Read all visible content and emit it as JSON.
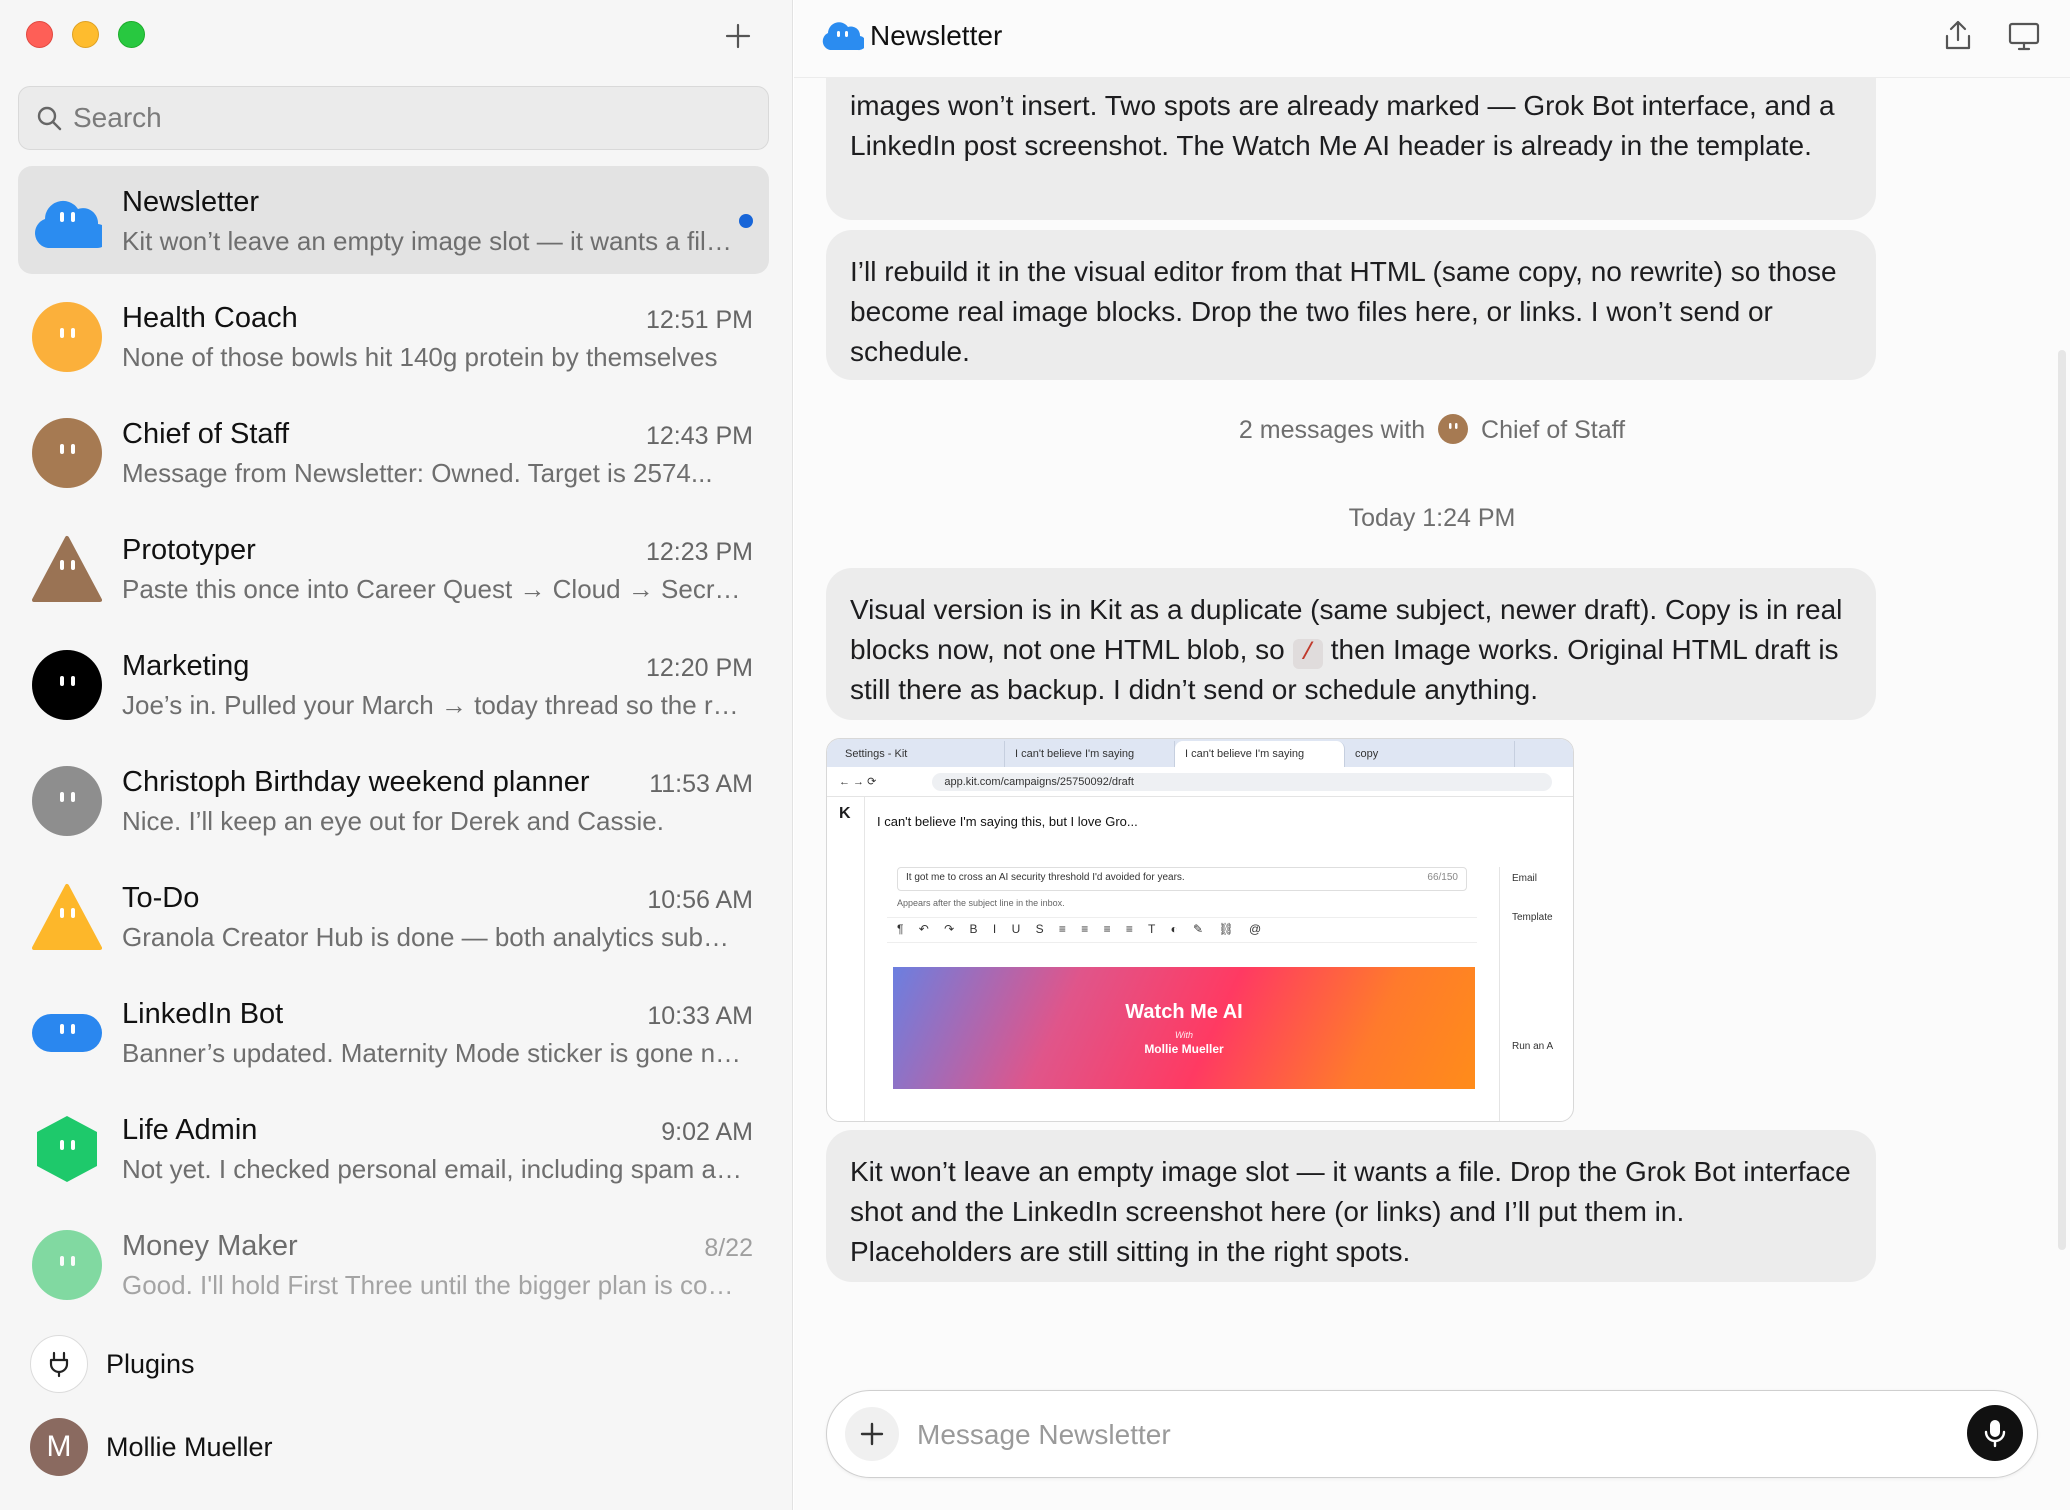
{
  "sidebar": {
    "search_placeholder": "Search",
    "chats": [
      {
        "name": "Newsletter",
        "time": "",
        "preview": "Kit won’t leave an empty image slot — it wants a file. Drop the Grok Bot interface shot",
        "unread": true,
        "color": "#2b8cf0",
        "shape": "cloud"
      },
      {
        "name": "Health Coach",
        "time": "12:51 PM",
        "preview": "None of those bowls hit 140g protein by themselves",
        "color": "#fbb03b",
        "shape": "circle"
      },
      {
        "name": "Chief of Staff",
        "time": "12:43 PM",
        "preview": "Message from Newsletter: Owned. Target is 2574...",
        "color": "#a67a52",
        "shape": "circle"
      },
      {
        "name": "Prototyper",
        "time": "12:23 PM",
        "preview": "Paste this once into Career Quest → Cloud → Secrets",
        "color": "#9a7354",
        "shape": "triangle"
      },
      {
        "name": "Marketing",
        "time": "12:20 PM",
        "preview": "Joe’s in. Pulled your March → today thread so the rest",
        "color": "#000000",
        "shape": "circle"
      },
      {
        "name": "Christoph Birthday weekend planner",
        "time": "11:53 AM",
        "preview": "Nice. I’ll keep an eye out for Derek and Cassie.",
        "color": "#8e8e8e",
        "shape": "circle"
      },
      {
        "name": "To-Do",
        "time": "10:56 AM",
        "preview": "Granola Creator Hub is done — both analytics subpages",
        "color": "#fdb72a",
        "shape": "triangle"
      },
      {
        "name": "LinkedIn Bot",
        "time": "10:33 AM",
        "preview": "Banner’s updated. Maternity Mode sticker is gone now",
        "color": "#2a87ef",
        "shape": "pill"
      },
      {
        "name": "Life Admin",
        "time": "9:02 AM",
        "preview": "Not yet. I checked personal email, including spam and",
        "color": "#1ec96b",
        "shape": "hexagon"
      },
      {
        "name": "Money Maker",
        "time": "8/22",
        "preview": "Good. I'll hold First Three until the bigger plan is complete",
        "color": "#35c76a",
        "shape": "circle",
        "faded": true
      }
    ],
    "plugins_label": "Plugins",
    "user_initial": "M",
    "user_name": "Mollie Mueller"
  },
  "main": {
    "title": "Newsletter",
    "messages": {
      "m1": "images won’t insert. Two spots are already marked — Grok Bot interface, and a LinkedIn post screenshot. The Watch Me AI header is already in the template.",
      "m2": "I’ll rebuild it in the visual editor from that HTML (same copy, no rewrite) so those become real image blocks. Drop the two files here, or links. I won’t send or schedule.",
      "m3_before": "Visual version is in Kit as a duplicate (same subject, newer draft). Copy is in real blocks now, not one HTML blob, so",
      "m3_code": "/",
      "m3_after": "then Image works. Original HTML draft is still there as backup. I didn’t send or schedule anything.",
      "m4": "Kit won’t leave an empty image slot — it wants a file. Drop the Grok Bot interface shot and the LinkedIn screenshot here (or links) and I’ll put them in. Placeholders are still sitting in the right spots."
    },
    "system": {
      "messages_with_prefix": "2 messages with",
      "messages_with_agent": "Chief of Staff",
      "timestamp": "Today 1:24 PM"
    },
    "screenshot": {
      "tabs": [
        "Settings - Kit",
        "I can't believe I'm saying",
        "I can't believe I'm saying",
        "copy"
      ],
      "url": "app.kit.com/campaigns/25750092/draft",
      "heading": "I can't believe I'm saying this, but I love Gro...",
      "subject": "It got me to cross an AI security threshold I'd avoided for years.",
      "counter": "66/150",
      "hint": "Appears after the subject line in the inbox.",
      "banner_title": "Watch Me AI",
      "banner_with": "With",
      "banner_name": "Mollie Mueller",
      "panel_email": "Email",
      "panel_template": "Template",
      "panel_run": "Run an A"
    },
    "composer_placeholder": "Message Newsletter"
  }
}
